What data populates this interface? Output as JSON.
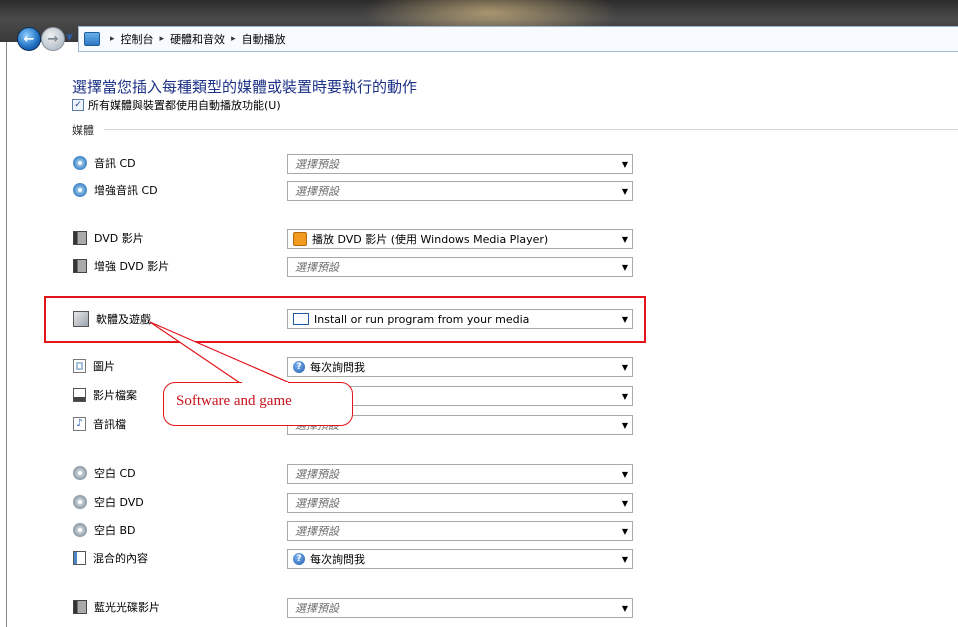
{
  "breadcrumb": [
    "控制台",
    "硬體和音效",
    "自動播放"
  ],
  "heading": "選擇當您插入每種類型的媒體或裝置時要執行的動作",
  "autoplay_checkbox": {
    "label": "所有媒體與裝置都使用自動播放功能(U)",
    "checked": true
  },
  "section_title": "媒體",
  "rows": [
    {
      "label": "音訊 CD",
      "icon": "audio-cd-icon",
      "value": "選擇預設",
      "placeholder": true
    },
    {
      "label": "增強音訊 CD",
      "icon": "enhanced-audio-cd-icon",
      "value": "選擇預設",
      "placeholder": true
    },
    {
      "label": "DVD 影片",
      "icon": "dvd-icon",
      "value": "播放 DVD 影片 (使用 Windows Media Player)",
      "placeholder": false
    },
    {
      "label": "增強 DVD 影片",
      "icon": "dvd-icon",
      "value": "選擇預設",
      "placeholder": true
    },
    {
      "label": "軟體及遊戲",
      "icon": "software-icon",
      "value": "Install or run program from your media",
      "placeholder": false
    },
    {
      "label": "圖片",
      "icon": "pictures-icon",
      "value": "每次詢問我",
      "placeholder": false
    },
    {
      "label": "影片檔案",
      "icon": "video-file-icon",
      "value": "",
      "placeholder": false
    },
    {
      "label": "音訊檔",
      "icon": "audio-file-icon",
      "value": "選擇預設",
      "placeholder": true
    },
    {
      "label": "空白 CD",
      "icon": "blank-cd-icon",
      "value": "選擇預設",
      "placeholder": true
    },
    {
      "label": "空白 DVD",
      "icon": "blank-dvd-icon",
      "value": "選擇預設",
      "placeholder": true
    },
    {
      "label": "空白 BD",
      "icon": "blank-bd-icon",
      "value": "選擇預設",
      "placeholder": true
    },
    {
      "label": "混合的內容",
      "icon": "mixed-content-icon",
      "value": "每次詢問我",
      "placeholder": false
    },
    {
      "label": "藍光光碟影片",
      "icon": "bluray-icon",
      "value": "選擇預設",
      "placeholder": true
    }
  ],
  "callout": {
    "text": "Software and game"
  },
  "colors": {
    "heading": "#1e3287",
    "highlight": "#e3151b"
  }
}
